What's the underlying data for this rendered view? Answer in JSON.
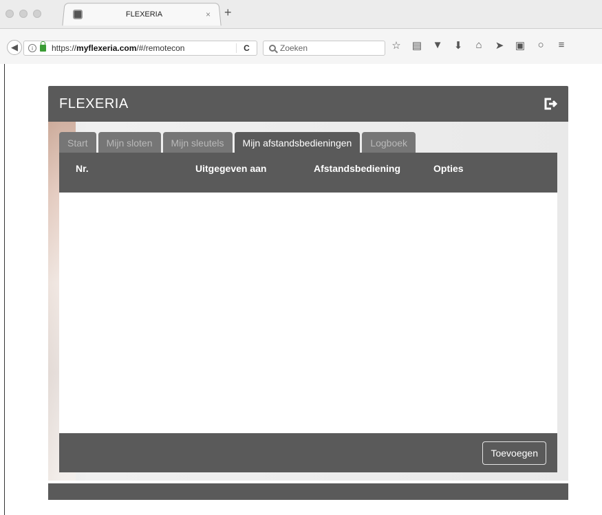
{
  "browser": {
    "tab_title": "FLEXERIA",
    "tab_close": "×",
    "new_tab": "+",
    "url_prefix": "https://",
    "url_domain": "myflexeria.com",
    "url_path": "/#/remotecon",
    "reload": "C",
    "search_placeholder": "Zoeken",
    "toolbar_icons": [
      "star-icon",
      "reading-list-icon",
      "pocket-icon",
      "download-icon",
      "home-icon",
      "send-icon",
      "translate-icon",
      "chat-icon",
      "menu-icon"
    ]
  },
  "app": {
    "title": "FLEXERIA",
    "tabs": [
      {
        "label": "Start",
        "active": false
      },
      {
        "label": "Mijn sloten",
        "active": false
      },
      {
        "label": "Mijn sleutels",
        "active": false
      },
      {
        "label": "Mijn afstandsbedieningen",
        "active": true
      },
      {
        "label": "Logboek",
        "active": false
      }
    ],
    "table": {
      "columns": [
        "Nr.",
        "Uitgegeven aan",
        "Afstandsbediening",
        "Opties"
      ],
      "rows": []
    },
    "add_button": "Toevoegen"
  },
  "colors": {
    "header": "#5a5a5a",
    "tab_inactive": "#767676",
    "accent_lock": "#3b9c35"
  }
}
